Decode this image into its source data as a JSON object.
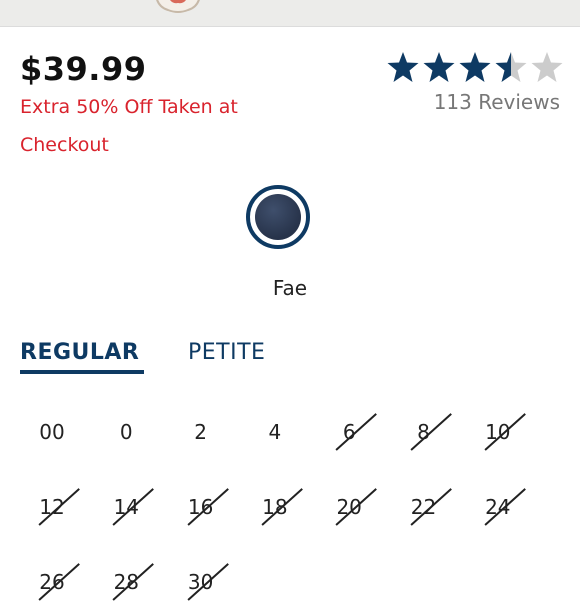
{
  "product": {
    "price": "$39.99",
    "promo": "Extra 50% Off Taken at Checkout",
    "rating": 3.5,
    "rating_max": 5,
    "reviews": "113 Reviews",
    "color_name": "Fae"
  },
  "colors": {
    "star_filled": "#0e3a63",
    "star_empty": "#cccccc",
    "promo": "#d9232d",
    "accent": "#0e3a63"
  },
  "tabs": [
    {
      "label": "REGULAR",
      "active": true
    },
    {
      "label": "PETITE",
      "active": false
    }
  ],
  "sizes": [
    {
      "label": "00",
      "available": true
    },
    {
      "label": "0",
      "available": true
    },
    {
      "label": "2",
      "available": true
    },
    {
      "label": "4",
      "available": true
    },
    {
      "label": "6",
      "available": false
    },
    {
      "label": "8",
      "available": false
    },
    {
      "label": "10",
      "available": false
    },
    {
      "label": "12",
      "available": false
    },
    {
      "label": "14",
      "available": false
    },
    {
      "label": "16",
      "available": false
    },
    {
      "label": "18",
      "available": false
    },
    {
      "label": "20",
      "available": false
    },
    {
      "label": "22",
      "available": false
    },
    {
      "label": "24",
      "available": false
    },
    {
      "label": "26",
      "available": false
    },
    {
      "label": "28",
      "available": false
    },
    {
      "label": "30",
      "available": false
    }
  ]
}
